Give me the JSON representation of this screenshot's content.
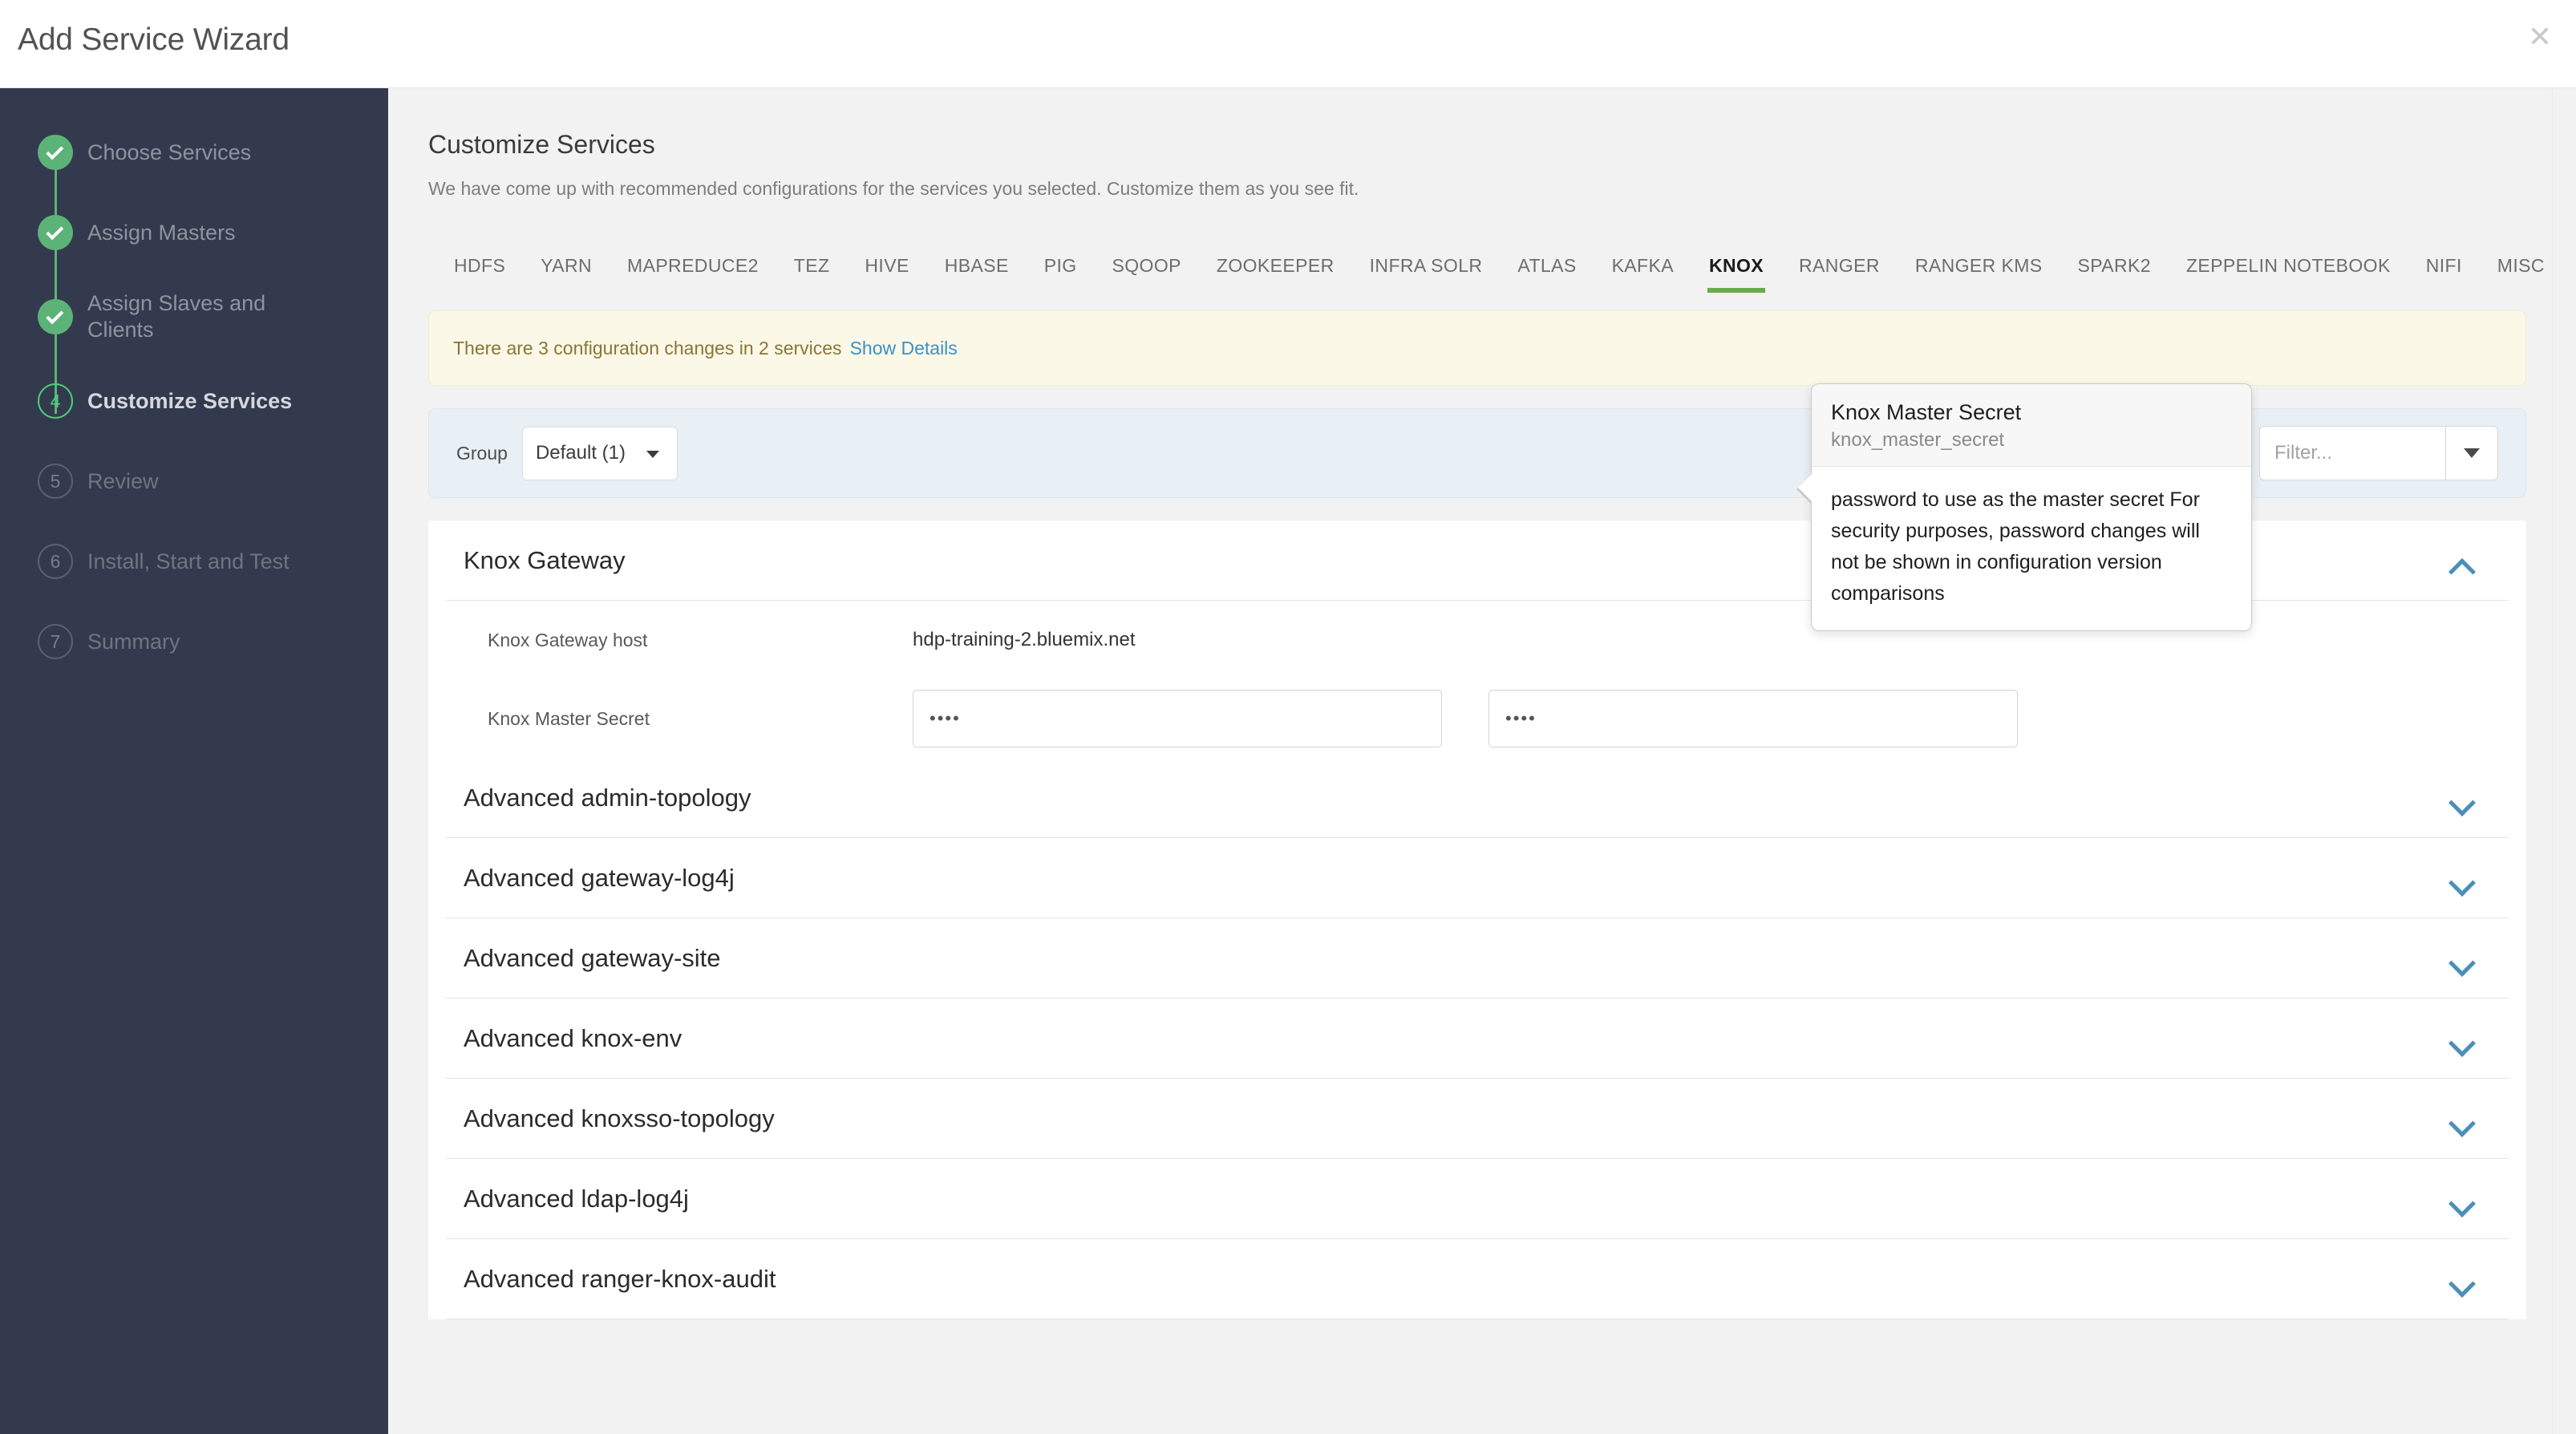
{
  "window": {
    "title": "Add Service Wizard",
    "close_label": "✕"
  },
  "sidebar": {
    "steps": [
      {
        "num": "1",
        "label": "Choose Services",
        "state": "done"
      },
      {
        "num": "2",
        "label": "Assign Masters",
        "state": "done"
      },
      {
        "num": "3",
        "label": "Assign Slaves and Clients",
        "state": "done"
      },
      {
        "num": "4",
        "label": "Customize Services",
        "state": "current"
      },
      {
        "num": "5",
        "label": "Review",
        "state": "pending"
      },
      {
        "num": "6",
        "label": "Install, Start and Test",
        "state": "pending"
      },
      {
        "num": "7",
        "label": "Summary",
        "state": "pending"
      }
    ]
  },
  "page": {
    "title": "Customize Services",
    "subtitle": "We have come up with recommended configurations for the services you selected. Customize them as you see fit."
  },
  "tabs": {
    "items": [
      "HDFS",
      "YARN",
      "MAPREDUCE2",
      "TEZ",
      "HIVE",
      "HBASE",
      "PIG",
      "SQOOP",
      "ZOOKEEPER",
      "INFRA SOLR",
      "ATLAS",
      "KAFKA",
      "KNOX",
      "RANGER",
      "RANGER KMS",
      "SPARK2",
      "ZEPPELIN NOTEBOOK",
      "NIFI",
      "MISC"
    ],
    "active": "KNOX"
  },
  "alert": {
    "text": "There are 3 configuration changes in 2 services",
    "link": "Show Details"
  },
  "group_bar": {
    "label": "Group",
    "selected": "Default (1)",
    "filter_placeholder": "Filter..."
  },
  "knox_gateway": {
    "title": "Knox Gateway",
    "rows": [
      {
        "label": "Knox Gateway host",
        "value": "hdp-training-2.bluemix.net",
        "type": "text"
      },
      {
        "label": "Knox Master Secret",
        "value": "••••",
        "confirm": "••••",
        "type": "password"
      }
    ]
  },
  "accordions": [
    "Advanced admin-topology",
    "Advanced gateway-log4j",
    "Advanced gateway-site",
    "Advanced knox-env",
    "Advanced knoxsso-topology",
    "Advanced ldap-log4j",
    "Advanced ranger-knox-audit"
  ],
  "popover": {
    "title": "Knox Master Secret",
    "subtitle": "knox_master_secret",
    "body": "password to use as the master secret For security purposes, password changes will not be shown in configuration version comparisons"
  },
  "colors": {
    "accent_green": "#6aab47",
    "step_done": "#5cb377",
    "step_current": "#4cd07d",
    "link_blue": "#3b90c9",
    "chevron_blue": "#4a90b8",
    "sidebar_bg": "#343a4d",
    "alert_bg": "#fbf8e7",
    "group_bg": "#e8eff5"
  }
}
